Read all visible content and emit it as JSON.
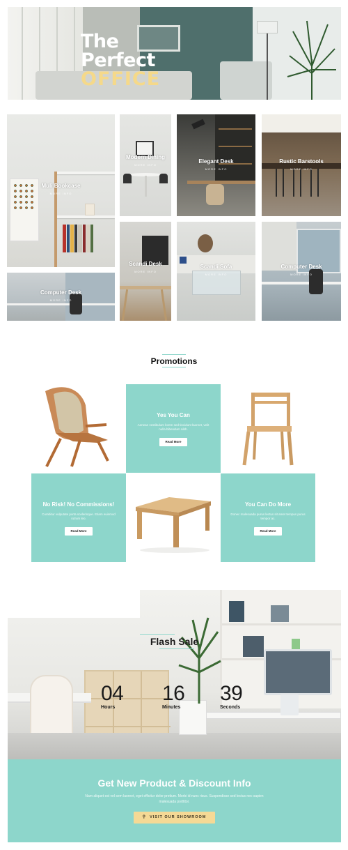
{
  "hero": {
    "title_line1": "The",
    "title_line2": "Perfect",
    "title_line3": "OFFICE"
  },
  "gallery": {
    "more_label": "MORE INFO",
    "items": [
      {
        "name": "Muli Bookcase"
      },
      {
        "name": "Modern Dining"
      },
      {
        "name": "Elegant Desk"
      },
      {
        "name": "Rustic Barstools"
      },
      {
        "name": "Scandi Desk"
      },
      {
        "name": "Scandi Sofa"
      },
      {
        "name": "Computer Desk"
      },
      {
        "name": "Computer Desk"
      }
    ]
  },
  "promotions": {
    "title": "Promotions",
    "blocks": [
      {
        "title": "Yes You Can",
        "text": "Aenean vestibulum lorem sed tincidunt laoreet, velit nulla bibendum nibh.",
        "button": "Read More"
      },
      {
        "title": "No Risk! No Commissions!",
        "text": "Curabitur vulputate porta scelerisque. Etiam euismod rutrum leo.",
        "button": "Read More"
      },
      {
        "title": "You Can Do More",
        "text": "Donec malesuada purus lectus sit amet tempus purus tempor ac.",
        "button": "Read More"
      }
    ]
  },
  "flash_sale": {
    "title": "Flash Sale",
    "hours": "04",
    "hours_label": "Hours",
    "minutes": "16",
    "minutes_label": "Minutes",
    "seconds": "39",
    "seconds_label": "Seconds"
  },
  "newsletter": {
    "title": "Get New Product & Discount Info",
    "text": "Nam aliquet est vel sem laoreet, eget efficitur dolor pretium. Morbi id nunc risus. Suspendisse sed lectus nec sapien malesuada porttitor.",
    "button": "VISIT OUR SHOWROOM"
  },
  "colors": {
    "teal": "#8dd6cb",
    "accent_yellow": "#f5d98a",
    "button_yellow": "#f5d995"
  }
}
